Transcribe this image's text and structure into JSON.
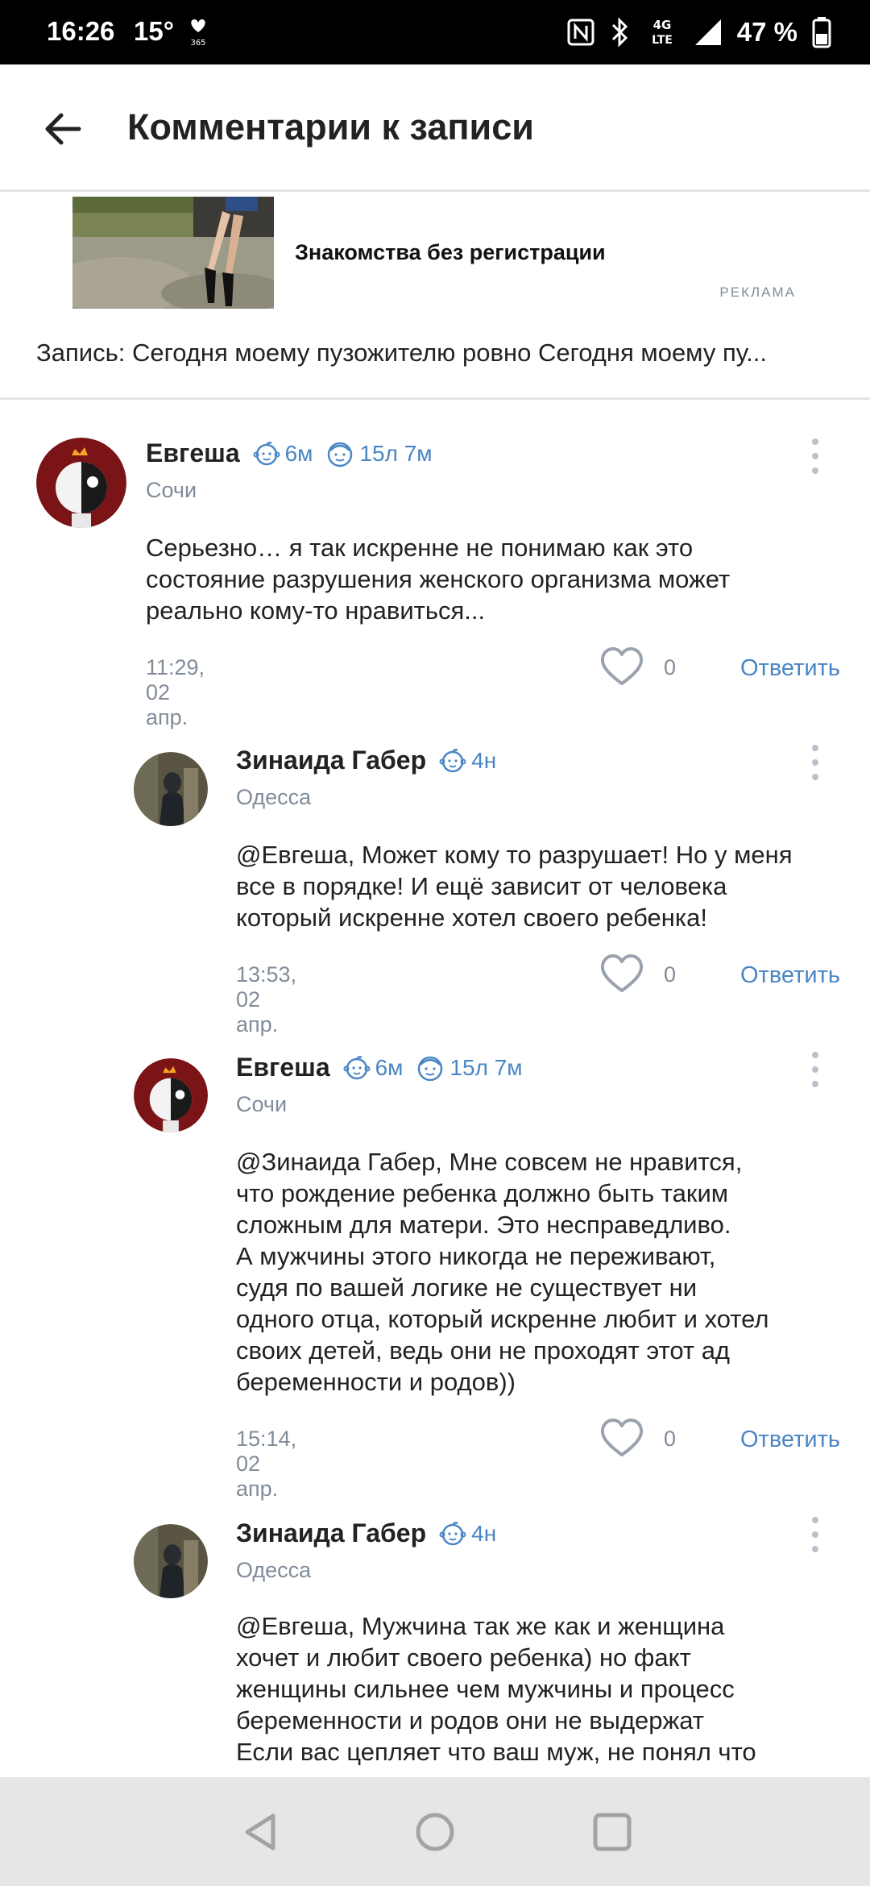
{
  "status": {
    "time": "16:26",
    "temp": "15°",
    "heart_label": "365",
    "network": "4G LTE",
    "battery": "47 %"
  },
  "header": {
    "title": "Комментарии к записи"
  },
  "ad": {
    "title": "Знакомства без регистрации",
    "label": "РЕКЛАМА"
  },
  "post_ref": "Запись: Сегодня моему пузожителю ровно Сегодня моему пу...",
  "comments": [
    {
      "name": "Евгеша",
      "badges": [
        "6м",
        "15л 7м"
      ],
      "city": "Сочи",
      "lines": [
        "Серьезно… я так искренне не понимаю как это",
        "состояние разрушения женского организма может",
        "реально кому-то нравиться..."
      ],
      "time": "11:29, 02 апр.",
      "likes": "0",
      "reply": "Ответить"
    },
    {
      "name": "Зинаида Габер",
      "badges": [
        "4н"
      ],
      "city": "Одесса",
      "lines": [
        "@Евгеша, Может кому то разрушает! Но у меня",
        "все в порядке! И ещё зависит от человека",
        "который искренне хотел своего ребенка!"
      ],
      "time": "13:53, 02 апр.",
      "likes": "0",
      "reply": "Ответить"
    },
    {
      "name": "Евгеша",
      "badges": [
        "6м",
        "15л 7м"
      ],
      "city": "Сочи",
      "lines": [
        "@Зинаида Габер, Мне совсем не нравится,",
        "что рождение ребенка должно быть таким",
        "сложным для матери. Это несправедливо.",
        "А мужчины этого никогда не переживают,",
        "судя по вашей логике не существует ни",
        "одного отца, который искренне любит и хотел",
        "своих детей, ведь они не проходят этот ад",
        "беременности и родов))"
      ],
      "time": "15:14, 02 апр.",
      "likes": "0",
      "reply": "Ответить"
    },
    {
      "name": "Зинаида Габер",
      "badges": [
        "4н"
      ],
      "city": "Одесса",
      "lines": [
        "@Евгеша, Мужчина так же как и женщина",
        "хочет и любит своего ребенка) но факт",
        "женщины сильнее чем мужчины и процесс",
        "беременности и родов они не выдержат",
        "Если вас цепляет что ваш муж, не понял что"
      ]
    }
  ]
}
